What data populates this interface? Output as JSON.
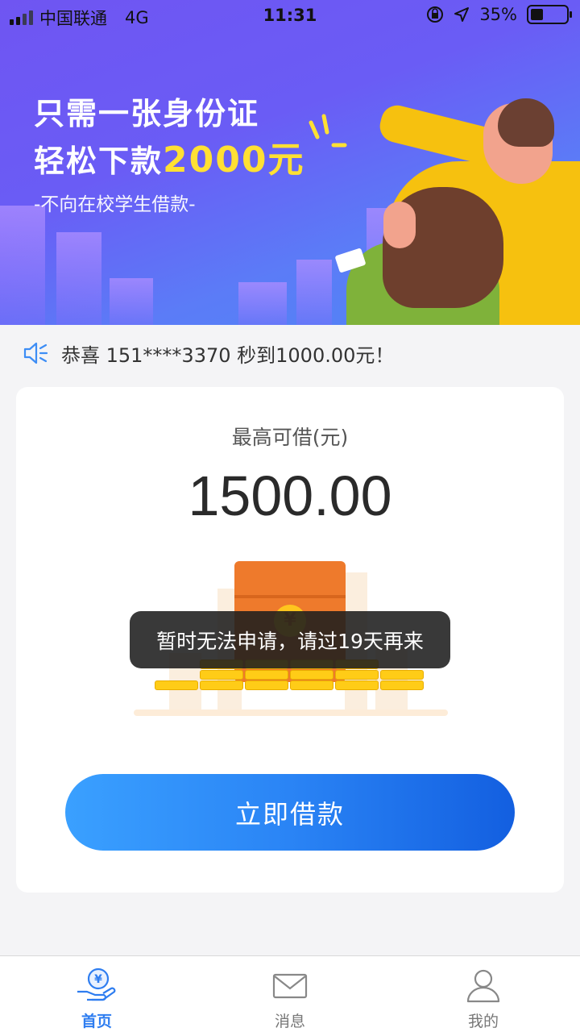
{
  "status_bar": {
    "carrier": "中国联通",
    "network": "4G",
    "time": "11:31",
    "battery_percent": "35%",
    "battery_level": 0.35
  },
  "banner": {
    "headline_line1": "只需一张身份证",
    "headline_line2_prefix": "轻松下款",
    "headline_amount": "2000元",
    "subline": "-不向在校学生借款-"
  },
  "notice": {
    "icon": "speaker-icon",
    "text": "恭喜 151****3370 秒到1000.00元！"
  },
  "loan_card": {
    "max_label": "最高可借(元)",
    "max_amount": "1500.00",
    "yuan_symbol": "¥",
    "button_label": "立即借款"
  },
  "toast": {
    "message": "暂时无法申请，请过19天再来"
  },
  "tabbar": {
    "items": [
      {
        "label": "首页",
        "icon": "hand-yuan-icon",
        "active": true
      },
      {
        "label": "消息",
        "icon": "envelope-icon",
        "active": false
      },
      {
        "label": "我的",
        "icon": "person-icon",
        "active": false
      }
    ]
  },
  "colors": {
    "accent": "#2e7df0",
    "banner_gradient_start": "#6f55f2",
    "banner_gradient_end": "#4e86f5",
    "highlight_yellow": "#ffe033"
  }
}
